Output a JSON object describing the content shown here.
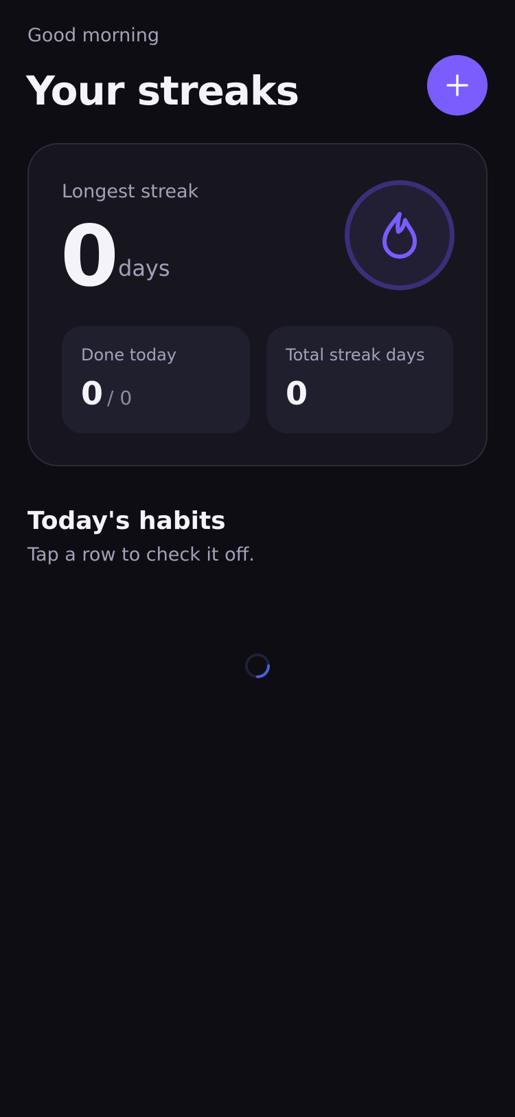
{
  "header": {
    "greeting": "Good morning",
    "title": "Your streaks",
    "add_icon": "plus-icon"
  },
  "summary": {
    "longest_label": "Longest streak",
    "longest_value": "0",
    "longest_unit": "days",
    "flame_icon": "flame-icon",
    "done_today": {
      "label": "Done today",
      "value": "0",
      "total": "/ 0"
    },
    "total_streak_days": {
      "label": "Total streak days",
      "value": "0"
    }
  },
  "habits_section": {
    "title": "Today's habits",
    "subtitle": "Tap a row to check it off.",
    "loading_icon": "loading-spinner-icon"
  },
  "colors": {
    "background": "#0e0d13",
    "card": "#17161f",
    "tile": "#201f2e",
    "accent": "#7b5cff",
    "flame": "#7a5cff",
    "spinner_track": "#1f2137",
    "spinner_arc": "#4a62d8"
  }
}
